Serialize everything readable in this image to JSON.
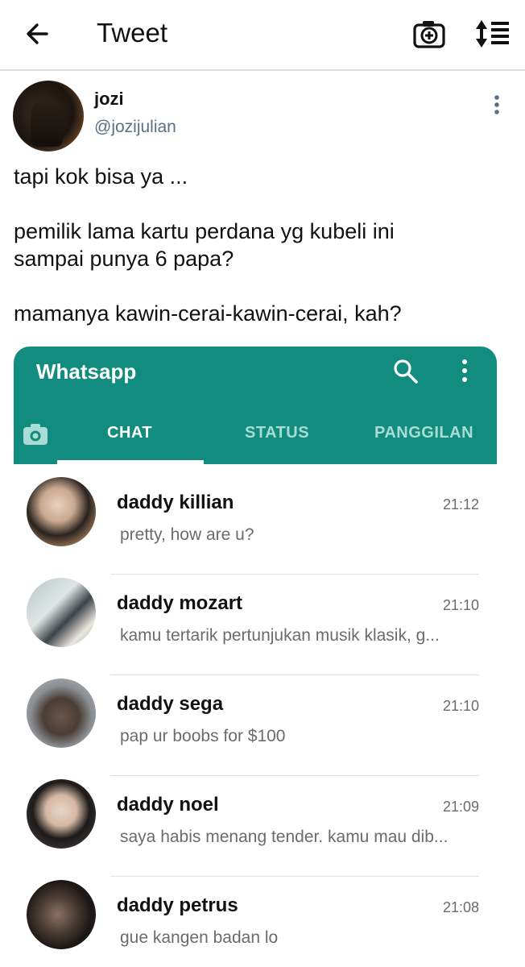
{
  "appbar": {
    "title": "Tweet"
  },
  "tweet": {
    "name": "jozi",
    "handle": "@jozijulian",
    "lines": [
      "tapi kok bisa ya ...",
      "pemilik lama kartu perdana yg kubeli ini",
      "sampai punya 6 papa?",
      "mamanya kawin-cerai-kawin-cerai, kah?"
    ]
  },
  "whatsapp": {
    "title": "Whatsapp",
    "tabs": [
      "CHAT",
      "STATUS",
      "PANGGILAN"
    ],
    "active_tab": "CHAT",
    "accent_color": "#128c7e",
    "chats": [
      {
        "name": "daddy killian",
        "time": "21:12",
        "message": "pretty, how are u?"
      },
      {
        "name": "daddy mozart",
        "time": "21:10",
        "message": "kamu tertarik pertunjukan musik klasik, g..."
      },
      {
        "name": "daddy sega",
        "time": "21:10",
        "message": "pap ur boobs for $100"
      },
      {
        "name": "daddy noel",
        "time": "21:09",
        "message": "saya habis menang tender. kamu mau dib..."
      },
      {
        "name": "daddy petrus",
        "time": "21:08",
        "message": "gue kangen badan lo"
      }
    ]
  },
  "icons": {
    "back": "arrow-left-icon",
    "camera": "camera-plus-icon",
    "sort": "sort-icon",
    "more": "more-vertical-icon",
    "search": "search-icon",
    "wa_camera": "camera-icon"
  }
}
